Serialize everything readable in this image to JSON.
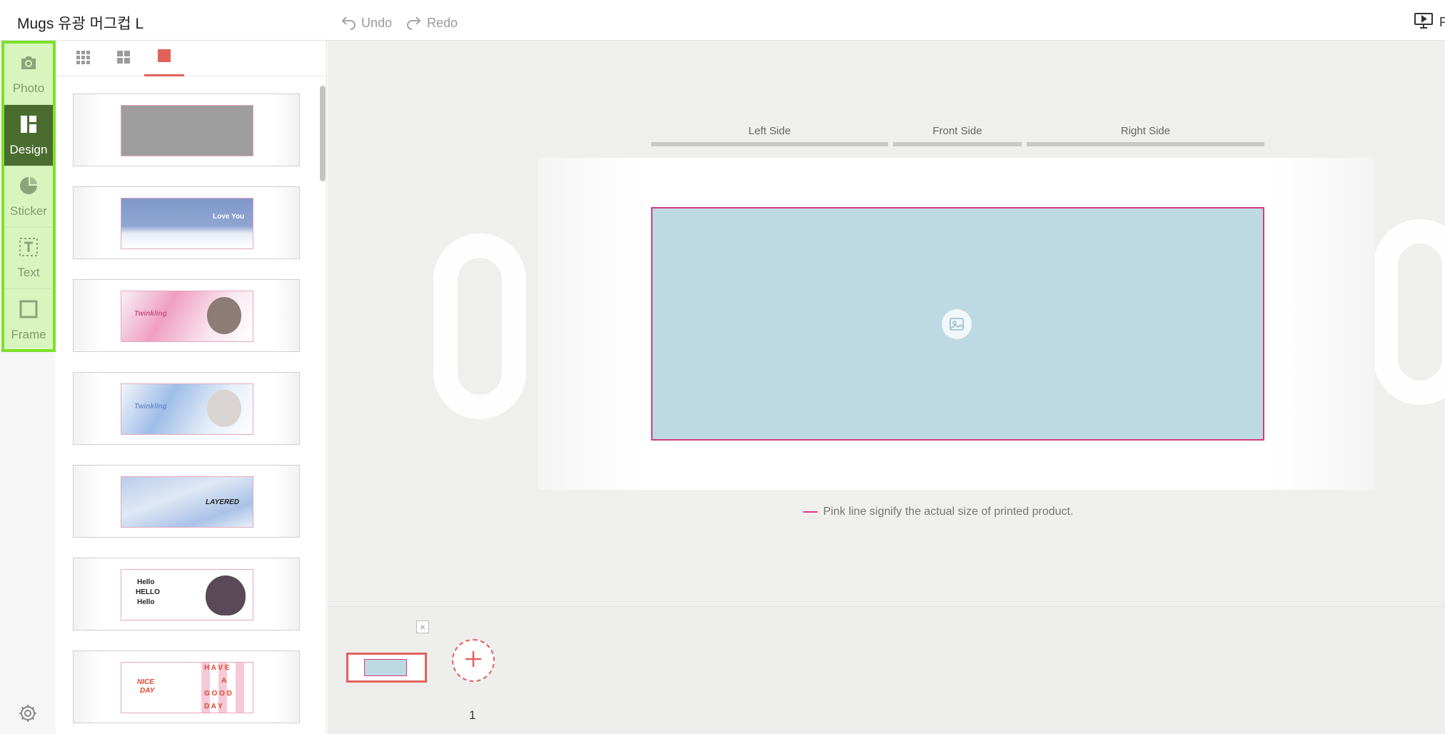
{
  "header": {
    "title": "Mugs 유광 머그컵 L",
    "undo_label": "Undo",
    "redo_label": "Redo",
    "preview_label": "P"
  },
  "rail": {
    "tools": [
      {
        "label": "Photo",
        "icon": "camera-icon",
        "active": false
      },
      {
        "label": "Design",
        "icon": "layout-icon",
        "active": true
      },
      {
        "label": "Sticker",
        "icon": "sticker-icon",
        "active": false
      },
      {
        "label": "Text",
        "icon": "text-icon",
        "active": false
      },
      {
        "label": "Frame",
        "icon": "frame-icon",
        "active": false
      }
    ],
    "settings_icon": "gear-icon",
    "highlight_color": "#7ee02a"
  },
  "panel": {
    "tabs": [
      {
        "icon": "grid-9-icon",
        "active": false
      },
      {
        "icon": "grid-4-icon",
        "active": false
      },
      {
        "icon": "square-icon",
        "active": true
      }
    ],
    "templates": [
      {
        "name": "template-gray",
        "texts": []
      },
      {
        "name": "template-cloud-sky",
        "texts": [
          "Love You"
        ]
      },
      {
        "name": "template-pink-twinkling",
        "texts": [
          "Twinkling"
        ]
      },
      {
        "name": "template-blue-twinkling",
        "texts": [
          "Twinkling"
        ]
      },
      {
        "name": "template-layered-sky",
        "texts": [
          "LAYERED"
        ]
      },
      {
        "name": "template-hello-heart",
        "texts": [
          "Hello",
          "HELLO",
          "Hello"
        ]
      },
      {
        "name": "template-have-a-good-day",
        "texts": [
          "NICE",
          "DAY",
          "H A V E",
          "A",
          "G O O D",
          "D A Y"
        ]
      }
    ]
  },
  "canvas": {
    "side_labels": [
      "Left Side",
      "Front Side",
      "Right Side"
    ],
    "print_area_color": "#bcd9e4",
    "print_line_color": "#d63a84",
    "placeholder_icon": "image-icon",
    "note": "Pink line signify the actual size of printed product."
  },
  "pages": {
    "items": [
      {
        "number": "1",
        "selected": true
      }
    ],
    "close_label": "×",
    "add_icon": "plus-icon"
  }
}
